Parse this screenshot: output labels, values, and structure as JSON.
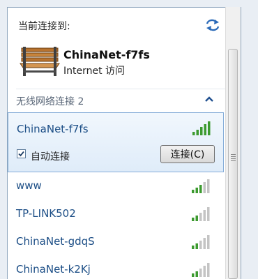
{
  "header": {
    "current_label": "当前连接到:",
    "refresh_icon": "refresh-icon"
  },
  "current_connection": {
    "name": "ChinaNet-f7fs",
    "status": "Internet 访问",
    "icon": "bench-icon"
  },
  "section": {
    "title": "无线网络连接 2",
    "collapse_icon": "chevron-up-icon"
  },
  "selected_network": {
    "name": "ChinaNet-f7fs",
    "auto_connect_label": "自动连接",
    "auto_connect_checked": true,
    "connect_button_label": "连接(C)",
    "signal_bars": 5
  },
  "networks": [
    {
      "name": "www",
      "signal_bars": 3
    },
    {
      "name": "TP-LINK502",
      "signal_bars": 2
    },
    {
      "name": "ChinaNet-gdqS",
      "signal_bars": 2
    },
    {
      "name": "ChinaNet-k2Kj",
      "signal_bars": 2
    }
  ],
  "colors": {
    "signal_active": "#3c9a2f",
    "signal_inactive": "#c4c4c4",
    "link_text": "#1c4e86"
  }
}
